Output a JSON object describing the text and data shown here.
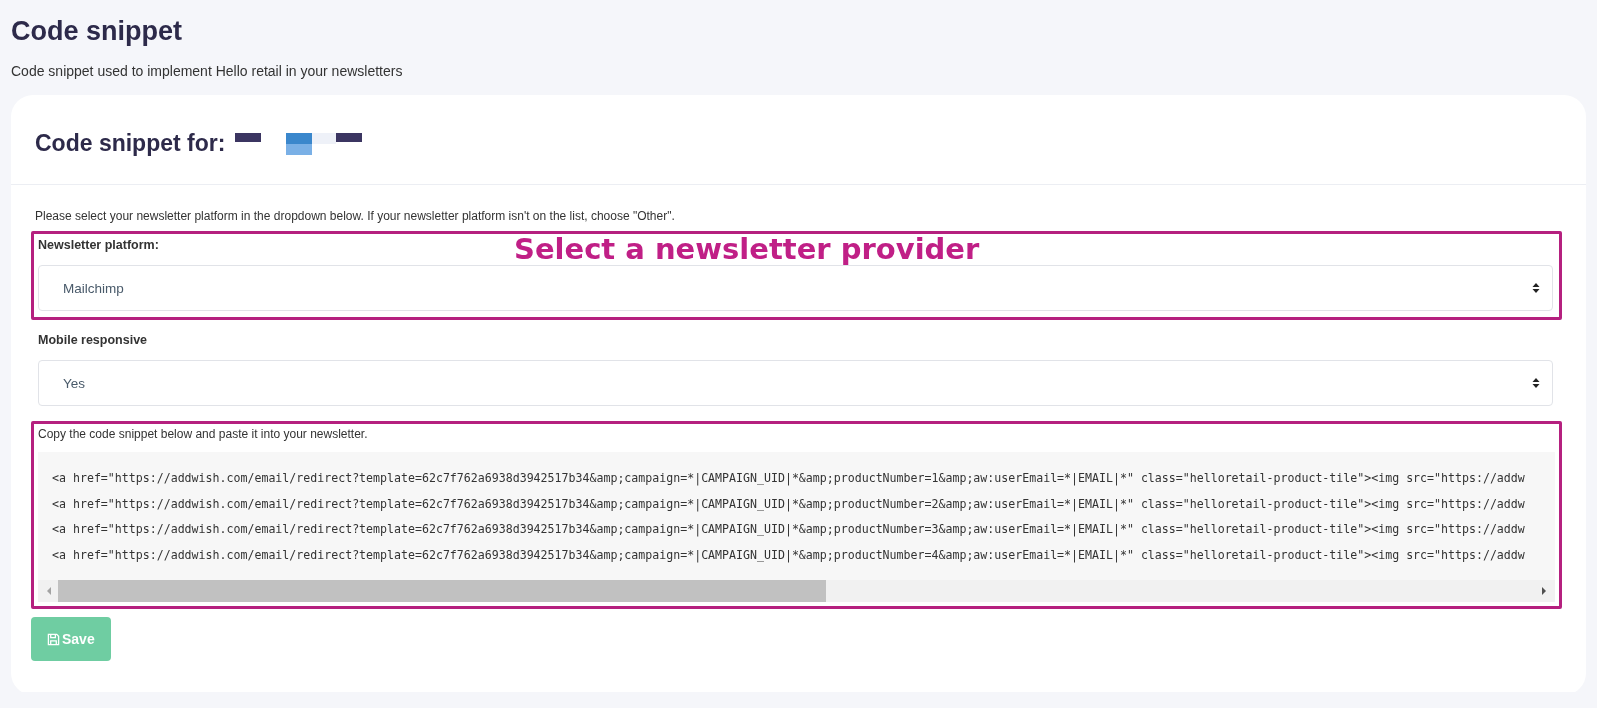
{
  "page": {
    "title": "Code snippet",
    "subtitle": "Code snippet used to implement Hello retail in your newsletters"
  },
  "card": {
    "title": "Code snippet for:",
    "redacted": true,
    "instructions": "Please select your newsletter platform in the dropdown below. If your newsletter platform isn't on the list, choose \"Other\".",
    "fields": [
      {
        "label": "Newsletter platform:",
        "value": "Mailchimp",
        "annotation": "Select a newsletter provider"
      },
      {
        "label": "Mobile responsive",
        "value": "Yes"
      }
    ],
    "snippet": {
      "label": "Copy the code snippet below and paste it into your newsletter.",
      "annotated": true,
      "lines": [
        "<a href=\"https://addwish.com/email/redirect?template=62c7f762a6938d3942517b34&amp;campaign=*|CAMPAIGN_UID|*&amp;productNumber=1&amp;aw:userEmail=*|EMAIL|*\" class=\"helloretail-product-tile\"><img src=\"https://addw",
        "<a href=\"https://addwish.com/email/redirect?template=62c7f762a6938d3942517b34&amp;campaign=*|CAMPAIGN_UID|*&amp;productNumber=2&amp;aw:userEmail=*|EMAIL|*\" class=\"helloretail-product-tile\"><img src=\"https://addw",
        "<a href=\"https://addwish.com/email/redirect?template=62c7f762a6938d3942517b34&amp;campaign=*|CAMPAIGN_UID|*&amp;productNumber=3&amp;aw:userEmail=*|EMAIL|*\" class=\"helloretail-product-tile\"><img src=\"https://addw",
        "<a href=\"https://addwish.com/email/redirect?template=62c7f762a6938d3942517b34&amp;campaign=*|CAMPAIGN_UID|*&amp;productNumber=4&amp;aw:userEmail=*|EMAIL|*\" class=\"helloretail-product-tile\"><img src=\"https://addw"
      ]
    },
    "save_button": {
      "label": "Save",
      "disabled": true
    }
  }
}
